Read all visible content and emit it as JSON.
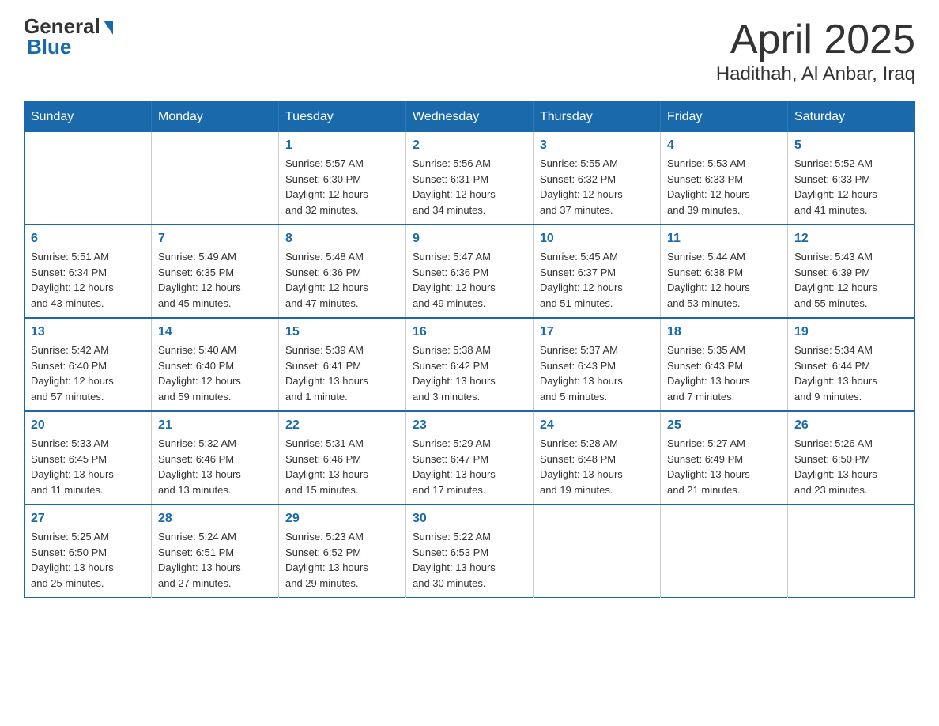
{
  "logo": {
    "general": "General",
    "blue": "Blue"
  },
  "title": "April 2025",
  "subtitle": "Hadithah, Al Anbar, Iraq",
  "headers": [
    "Sunday",
    "Monday",
    "Tuesday",
    "Wednesday",
    "Thursday",
    "Friday",
    "Saturday"
  ],
  "weeks": [
    [
      {
        "day": "",
        "info": ""
      },
      {
        "day": "",
        "info": ""
      },
      {
        "day": "1",
        "info": "Sunrise: 5:57 AM\nSunset: 6:30 PM\nDaylight: 12 hours\nand 32 minutes."
      },
      {
        "day": "2",
        "info": "Sunrise: 5:56 AM\nSunset: 6:31 PM\nDaylight: 12 hours\nand 34 minutes."
      },
      {
        "day": "3",
        "info": "Sunrise: 5:55 AM\nSunset: 6:32 PM\nDaylight: 12 hours\nand 37 minutes."
      },
      {
        "day": "4",
        "info": "Sunrise: 5:53 AM\nSunset: 6:33 PM\nDaylight: 12 hours\nand 39 minutes."
      },
      {
        "day": "5",
        "info": "Sunrise: 5:52 AM\nSunset: 6:33 PM\nDaylight: 12 hours\nand 41 minutes."
      }
    ],
    [
      {
        "day": "6",
        "info": "Sunrise: 5:51 AM\nSunset: 6:34 PM\nDaylight: 12 hours\nand 43 minutes."
      },
      {
        "day": "7",
        "info": "Sunrise: 5:49 AM\nSunset: 6:35 PM\nDaylight: 12 hours\nand 45 minutes."
      },
      {
        "day": "8",
        "info": "Sunrise: 5:48 AM\nSunset: 6:36 PM\nDaylight: 12 hours\nand 47 minutes."
      },
      {
        "day": "9",
        "info": "Sunrise: 5:47 AM\nSunset: 6:36 PM\nDaylight: 12 hours\nand 49 minutes."
      },
      {
        "day": "10",
        "info": "Sunrise: 5:45 AM\nSunset: 6:37 PM\nDaylight: 12 hours\nand 51 minutes."
      },
      {
        "day": "11",
        "info": "Sunrise: 5:44 AM\nSunset: 6:38 PM\nDaylight: 12 hours\nand 53 minutes."
      },
      {
        "day": "12",
        "info": "Sunrise: 5:43 AM\nSunset: 6:39 PM\nDaylight: 12 hours\nand 55 minutes."
      }
    ],
    [
      {
        "day": "13",
        "info": "Sunrise: 5:42 AM\nSunset: 6:40 PM\nDaylight: 12 hours\nand 57 minutes."
      },
      {
        "day": "14",
        "info": "Sunrise: 5:40 AM\nSunset: 6:40 PM\nDaylight: 12 hours\nand 59 minutes."
      },
      {
        "day": "15",
        "info": "Sunrise: 5:39 AM\nSunset: 6:41 PM\nDaylight: 13 hours\nand 1 minute."
      },
      {
        "day": "16",
        "info": "Sunrise: 5:38 AM\nSunset: 6:42 PM\nDaylight: 13 hours\nand 3 minutes."
      },
      {
        "day": "17",
        "info": "Sunrise: 5:37 AM\nSunset: 6:43 PM\nDaylight: 13 hours\nand 5 minutes."
      },
      {
        "day": "18",
        "info": "Sunrise: 5:35 AM\nSunset: 6:43 PM\nDaylight: 13 hours\nand 7 minutes."
      },
      {
        "day": "19",
        "info": "Sunrise: 5:34 AM\nSunset: 6:44 PM\nDaylight: 13 hours\nand 9 minutes."
      }
    ],
    [
      {
        "day": "20",
        "info": "Sunrise: 5:33 AM\nSunset: 6:45 PM\nDaylight: 13 hours\nand 11 minutes."
      },
      {
        "day": "21",
        "info": "Sunrise: 5:32 AM\nSunset: 6:46 PM\nDaylight: 13 hours\nand 13 minutes."
      },
      {
        "day": "22",
        "info": "Sunrise: 5:31 AM\nSunset: 6:46 PM\nDaylight: 13 hours\nand 15 minutes."
      },
      {
        "day": "23",
        "info": "Sunrise: 5:29 AM\nSunset: 6:47 PM\nDaylight: 13 hours\nand 17 minutes."
      },
      {
        "day": "24",
        "info": "Sunrise: 5:28 AM\nSunset: 6:48 PM\nDaylight: 13 hours\nand 19 minutes."
      },
      {
        "day": "25",
        "info": "Sunrise: 5:27 AM\nSunset: 6:49 PM\nDaylight: 13 hours\nand 21 minutes."
      },
      {
        "day": "26",
        "info": "Sunrise: 5:26 AM\nSunset: 6:50 PM\nDaylight: 13 hours\nand 23 minutes."
      }
    ],
    [
      {
        "day": "27",
        "info": "Sunrise: 5:25 AM\nSunset: 6:50 PM\nDaylight: 13 hours\nand 25 minutes."
      },
      {
        "day": "28",
        "info": "Sunrise: 5:24 AM\nSunset: 6:51 PM\nDaylight: 13 hours\nand 27 minutes."
      },
      {
        "day": "29",
        "info": "Sunrise: 5:23 AM\nSunset: 6:52 PM\nDaylight: 13 hours\nand 29 minutes."
      },
      {
        "day": "30",
        "info": "Sunrise: 5:22 AM\nSunset: 6:53 PM\nDaylight: 13 hours\nand 30 minutes."
      },
      {
        "day": "",
        "info": ""
      },
      {
        "day": "",
        "info": ""
      },
      {
        "day": "",
        "info": ""
      }
    ]
  ]
}
